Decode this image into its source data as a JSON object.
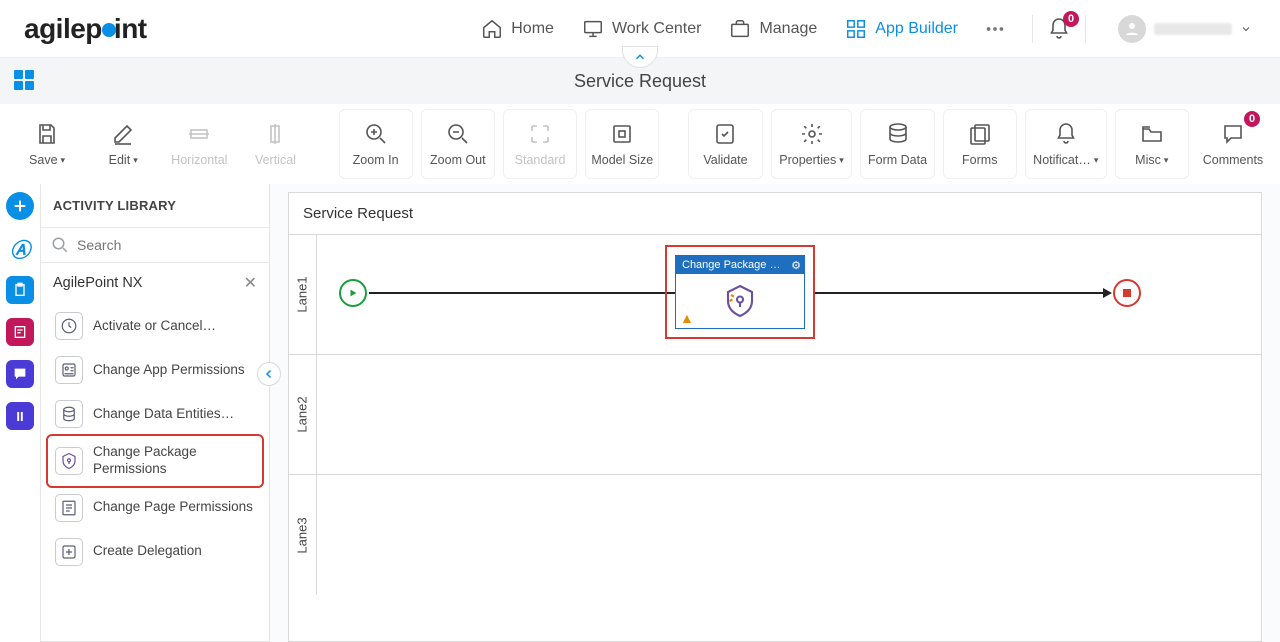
{
  "nav": {
    "home": "Home",
    "work_center": "Work Center",
    "manage": "Manage",
    "app_builder": "App Builder",
    "bell_badge": "0"
  },
  "page": {
    "title": "Service Request"
  },
  "toolbar": {
    "save": "Save",
    "edit": "Edit",
    "horizontal": "Horizontal",
    "vertical": "Vertical",
    "zoom_in": "Zoom In",
    "zoom_out": "Zoom Out",
    "standard": "Standard",
    "model_size": "Model Size",
    "validate": "Validate",
    "properties": "Properties",
    "form_data": "Form Data",
    "forms": "Forms",
    "notifications": "Notificat…",
    "misc": "Misc",
    "comments": "Comments",
    "comments_badge": "0"
  },
  "library": {
    "header": "ACTIVITY LIBRARY",
    "search_placeholder": "Search",
    "category": "AgilePoint NX",
    "items": [
      "Activate or Cancel…",
      "Change App Permissions",
      "Change Data Entities…",
      "Change Package Permissions",
      "Change Page Permissions",
      "Create Delegation"
    ],
    "highlight_index": 3
  },
  "canvas": {
    "title": "Service Request",
    "lanes": [
      "Lane1",
      "Lane2",
      "Lane3"
    ],
    "activity_title": "Change Package Permi..."
  }
}
